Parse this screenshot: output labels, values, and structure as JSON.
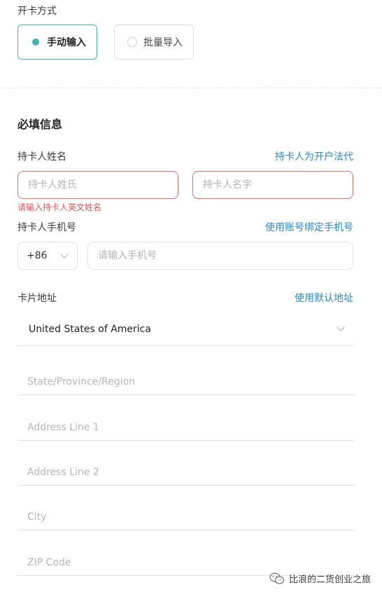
{
  "open_method": {
    "label": "开卡方式",
    "options": [
      {
        "label": "手动输入",
        "selected": true
      },
      {
        "label": "批量导入",
        "selected": false
      }
    ]
  },
  "required": {
    "title": "必填信息",
    "name": {
      "label": "持卡人姓名",
      "link": "持卡人为开户法代",
      "last_placeholder": "持卡人姓氏",
      "first_placeholder": "持卡人名字",
      "error": "请输入持卡人英文姓名"
    },
    "phone": {
      "label": "持卡人手机号",
      "link": "使用账号绑定手机号",
      "country_code": "+86",
      "placeholder": "请输入手机号"
    },
    "address": {
      "label": "卡片地址",
      "link": "使用默认地址",
      "country": "United States of America",
      "state_placeholder": "State/Province/Region",
      "line1_placeholder": "Address Line 1",
      "line2_placeholder": "Address Line 2",
      "city_placeholder": "City",
      "zip_placeholder": "ZIP Code"
    }
  },
  "watermark": "比浪的二货创业之旅",
  "colors": {
    "accent": "#3fb6ae",
    "link": "#2a86d6",
    "error": "#e05555"
  }
}
